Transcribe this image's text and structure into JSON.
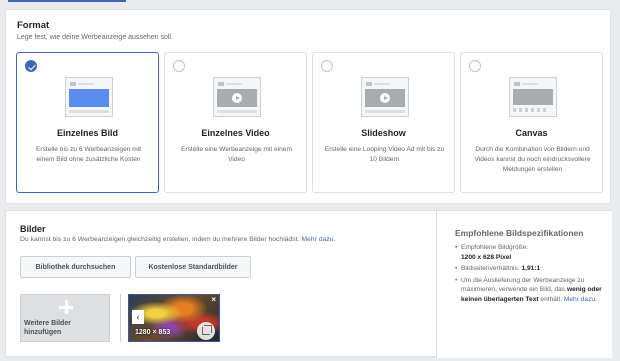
{
  "format": {
    "title": "Format",
    "subtitle": "Lege fest, wie deine Werbeanzeige aussehen soll.",
    "options": [
      {
        "title": "Einzelnes Bild",
        "description": "Erstelle bis zu 6 Werbeanzeigen mit einem Bild ohne zusätzliche Kosten",
        "selected": true
      },
      {
        "title": "Einzelnes Video",
        "description": "Erstelle eine Werbeanzeige mit einem Video",
        "selected": false
      },
      {
        "title": "Slideshow",
        "description": "Erstelle eine Looping Video Ad mit bis zu 10 Bildern",
        "selected": false
      },
      {
        "title": "Canvas",
        "description": "Durch die Kombination von Bildern und Videos kannst du noch eindrucksvollere Meldungen erstellen",
        "selected": false
      }
    ]
  },
  "bilder": {
    "title": "Bilder",
    "subtitle": "Du kannst bis zu 6 Werbeanzeigen gleichzeitig erstellen, indem du mehrere Bilder hochlädst.",
    "more_link": "Mehr dazu.",
    "library_button": "Bibliothek durchsuchen",
    "stock_button": "Kostenlose Standardbilder",
    "add_more_line1": "Weitere Bilder",
    "add_more_line2": "hinzufügen",
    "image_size": "1280 × 853",
    "image_close": "×",
    "image_prev": "‹"
  },
  "spec": {
    "title": "Empfohlene Bildspezifikationen",
    "size_label": "Empfohlene Bildgröße:",
    "size_value": "1200 x 628 Pixel",
    "ratio_label": "Bildseitenverhältnis:",
    "ratio_value": "1,91:1",
    "text_pre": "Um die Auslieferung der Werbeanzeige zu maximieren, verwende ein Bild, das",
    "text_bold": "wenig oder keinen überlagerten Text",
    "text_post": "enthält.",
    "more_link": "Mehr dazu."
  },
  "colors": {
    "accent": "#4267b2",
    "background": "#e9ebee"
  }
}
